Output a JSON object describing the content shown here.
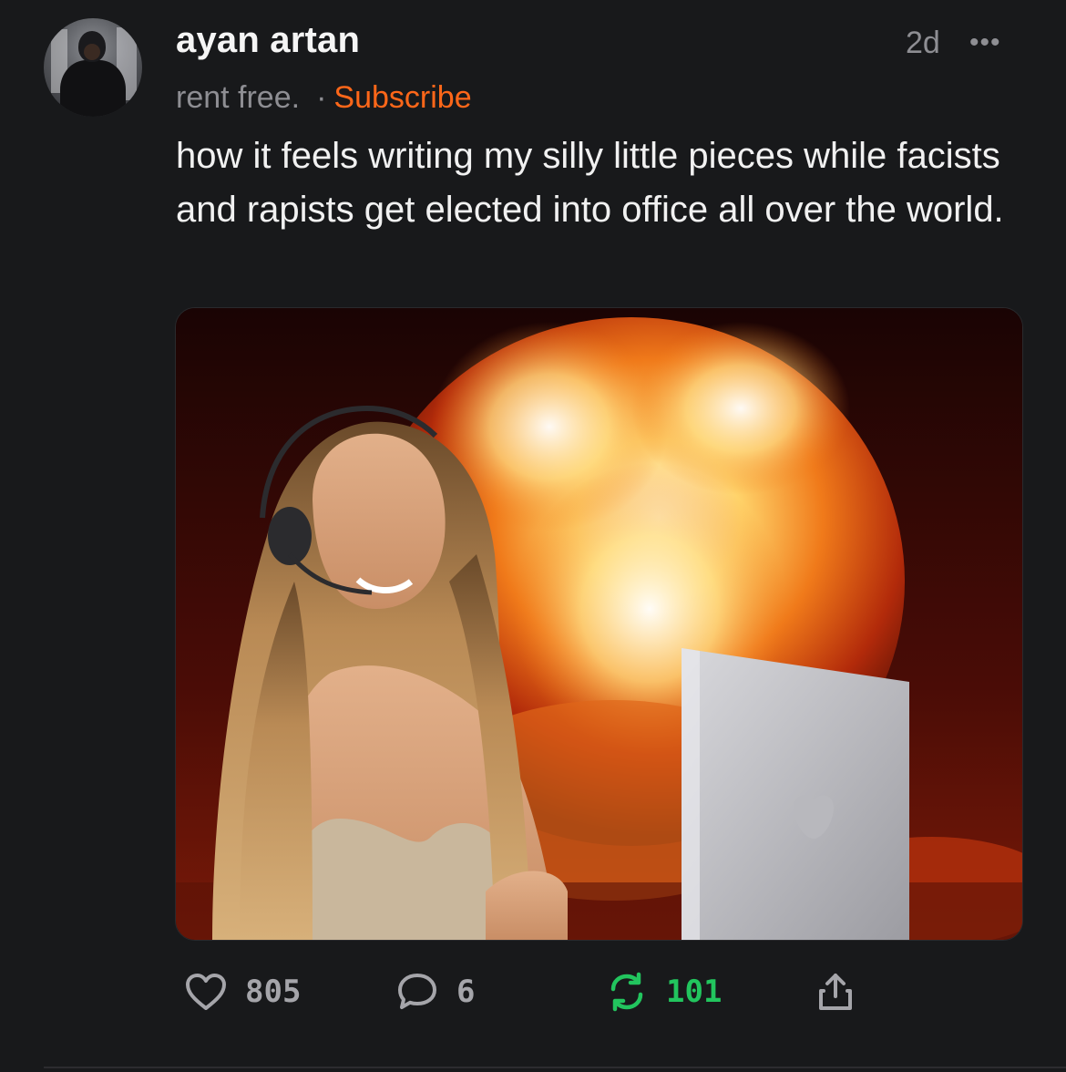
{
  "post": {
    "author": "ayan artan",
    "publication": "rent free.",
    "separator": "·",
    "subscribe_label": "Subscribe",
    "time_ago": "2d",
    "more_label": "•••",
    "text": "how it feels writing my silly little pieces while facists and rapists get elected into office all over the world."
  },
  "actions": {
    "likes": "805",
    "comments": "6",
    "restacks": "101"
  },
  "colors": {
    "background": "#18191b",
    "subscribe": "#ff6719",
    "restack_active": "#22c55e",
    "muted": "#8e8e93"
  },
  "icons": {
    "like": "heart-icon",
    "comment": "comment-bubble-icon",
    "restack": "restack-icon",
    "share": "share-icon",
    "more": "more-dots-icon"
  }
}
